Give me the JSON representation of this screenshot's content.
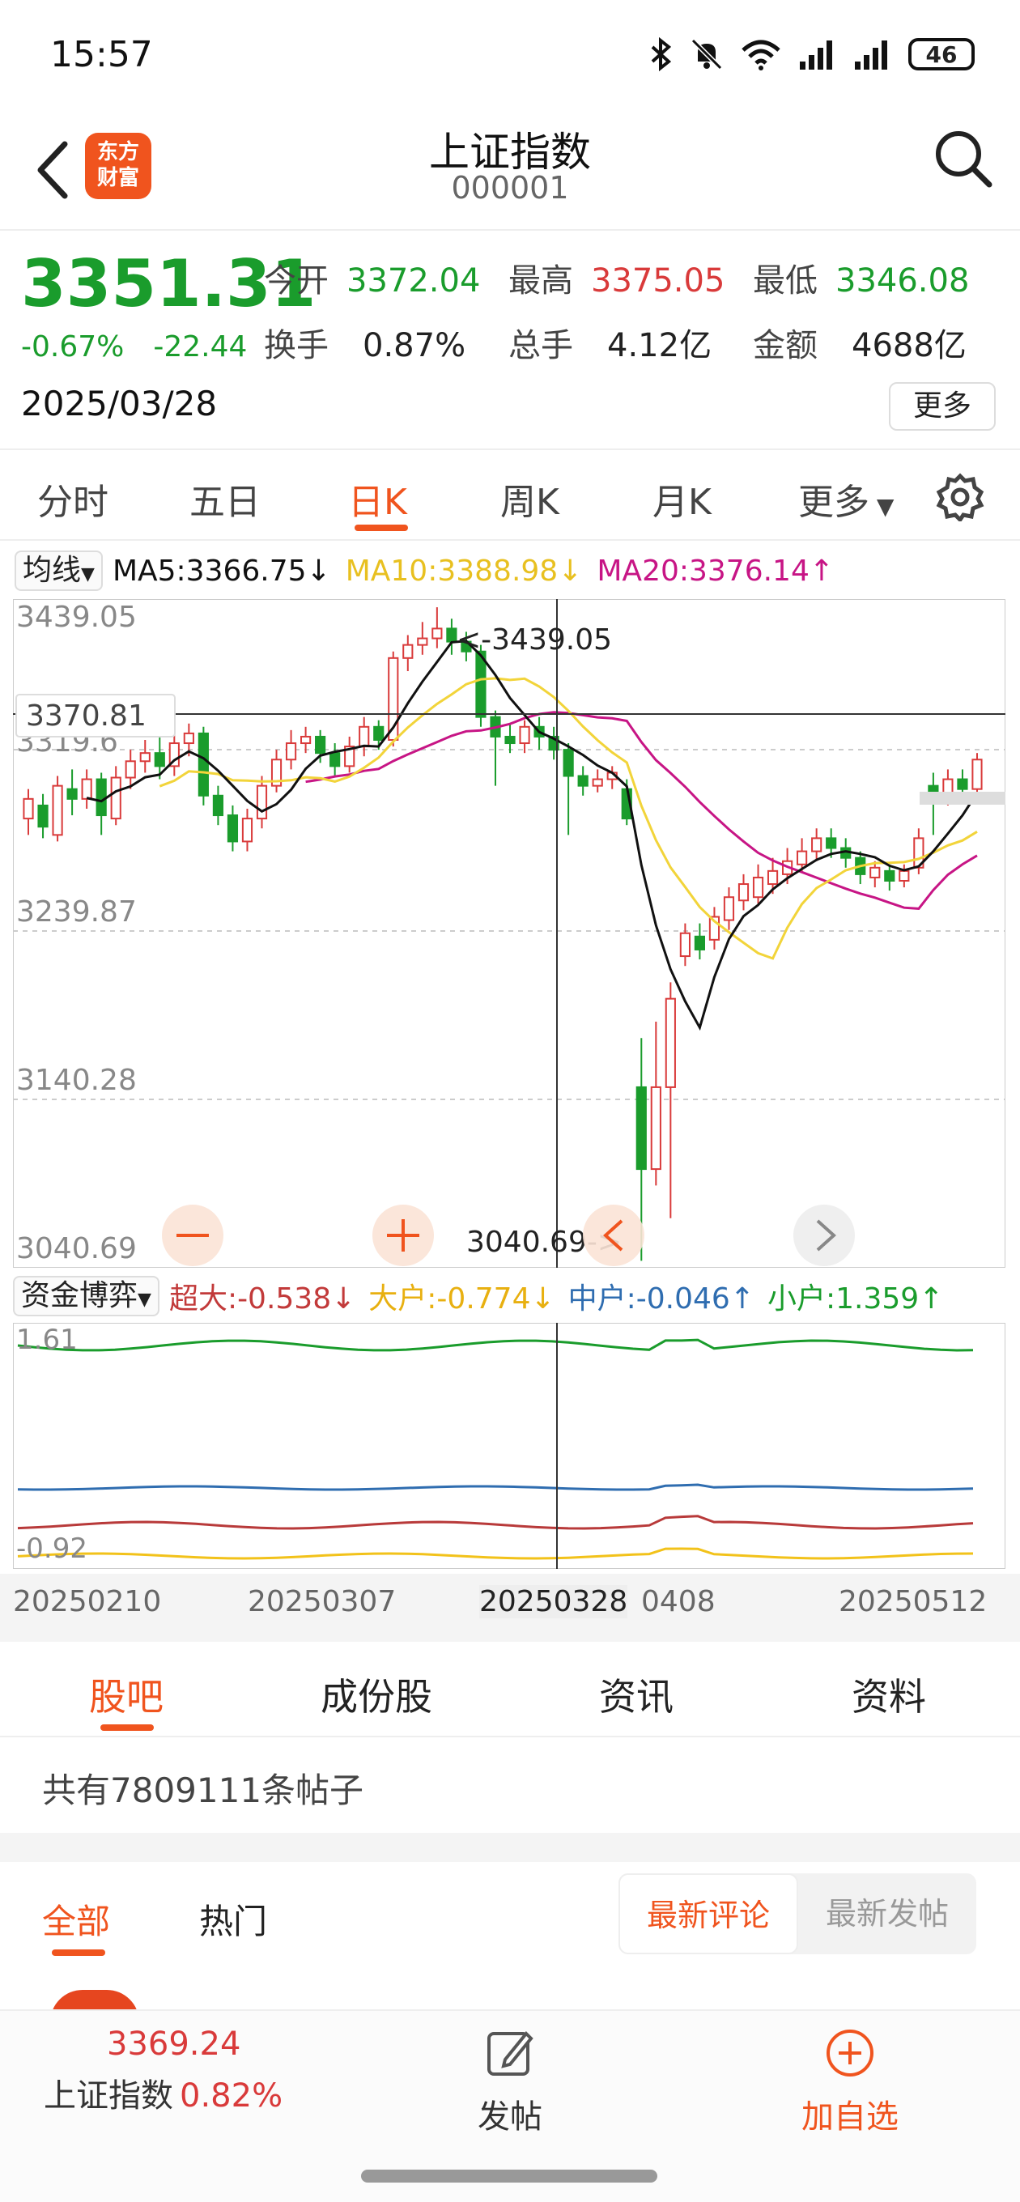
{
  "status_bar": {
    "time": "15:57",
    "battery": "46"
  },
  "header": {
    "back_icon": "chevron-left-icon",
    "logo_text_line1": "东方",
    "logo_text_line2": "财富",
    "title": "上证指数",
    "code": "000001",
    "search_icon": "search-icon"
  },
  "quote": {
    "price": "3351.31",
    "change_pct": "-0.67%",
    "change_abs": "-22.44",
    "date": "2025/03/28",
    "open_label": "今开",
    "open": "3372.04",
    "high_label": "最高",
    "high": "3375.05",
    "low_label": "最低",
    "low": "3346.08",
    "turnover_label": "换手",
    "turnover": "0.87%",
    "volume_label": "总手",
    "volume": "4.12亿",
    "amount_label": "金额",
    "amount": "4688亿",
    "more_label": "更多"
  },
  "period_tabs": [
    "分时",
    "五日",
    "日K",
    "周K",
    "月K",
    "更多"
  ],
  "active_period": "日K",
  "ma": {
    "selector": "均线",
    "ma5": "MA5:3366.75↓",
    "ma10": "MA10:3388.98↓",
    "ma20": "MA20:3376.14↑",
    "colors": {
      "ma5": "#111111",
      "ma10": "#f2d43a",
      "ma20": "#c71585"
    }
  },
  "kline": {
    "y_labels": [
      "3439.05",
      "3239.87",
      "3140.28",
      "3040.69"
    ],
    "y_label_overlap": "3319.6",
    "crosshair_price": "3370.81",
    "max_marker": "<-3439.05",
    "min_marker": "3040.69->",
    "up_color": "#d93a3a",
    "down_color": "#1a9c2c"
  },
  "flow": {
    "selector": "资金博弈",
    "super": "超大:-0.538↓",
    "large": "大户:-0.774↓",
    "medium": "中户:-0.046↑",
    "small": "小户:1.359↑",
    "y_top": "1.61",
    "y_bottom": "-0.92",
    "colors": {
      "super": "#b83a3a",
      "large": "#f2c21a",
      "medium": "#2f6db0",
      "small": "#1a9c2c"
    }
  },
  "dates": [
    "20250210",
    "20250307",
    "20250328",
    "0408",
    "20250512"
  ],
  "content_tabs": [
    "股吧",
    "成份股",
    "资讯",
    "资料"
  ],
  "active_content_tab": "股吧",
  "post_count": "共有7809111条帖子",
  "filters": {
    "all": "全部",
    "hot": "热门",
    "latest_comment": "最新评论",
    "latest_post": "最新发帖"
  },
  "bottom_bar": {
    "index_value": "3369.24",
    "index_name": "上证指数",
    "index_pct": "0.82%",
    "post_label": "发帖",
    "add_label": "加自选"
  }
}
